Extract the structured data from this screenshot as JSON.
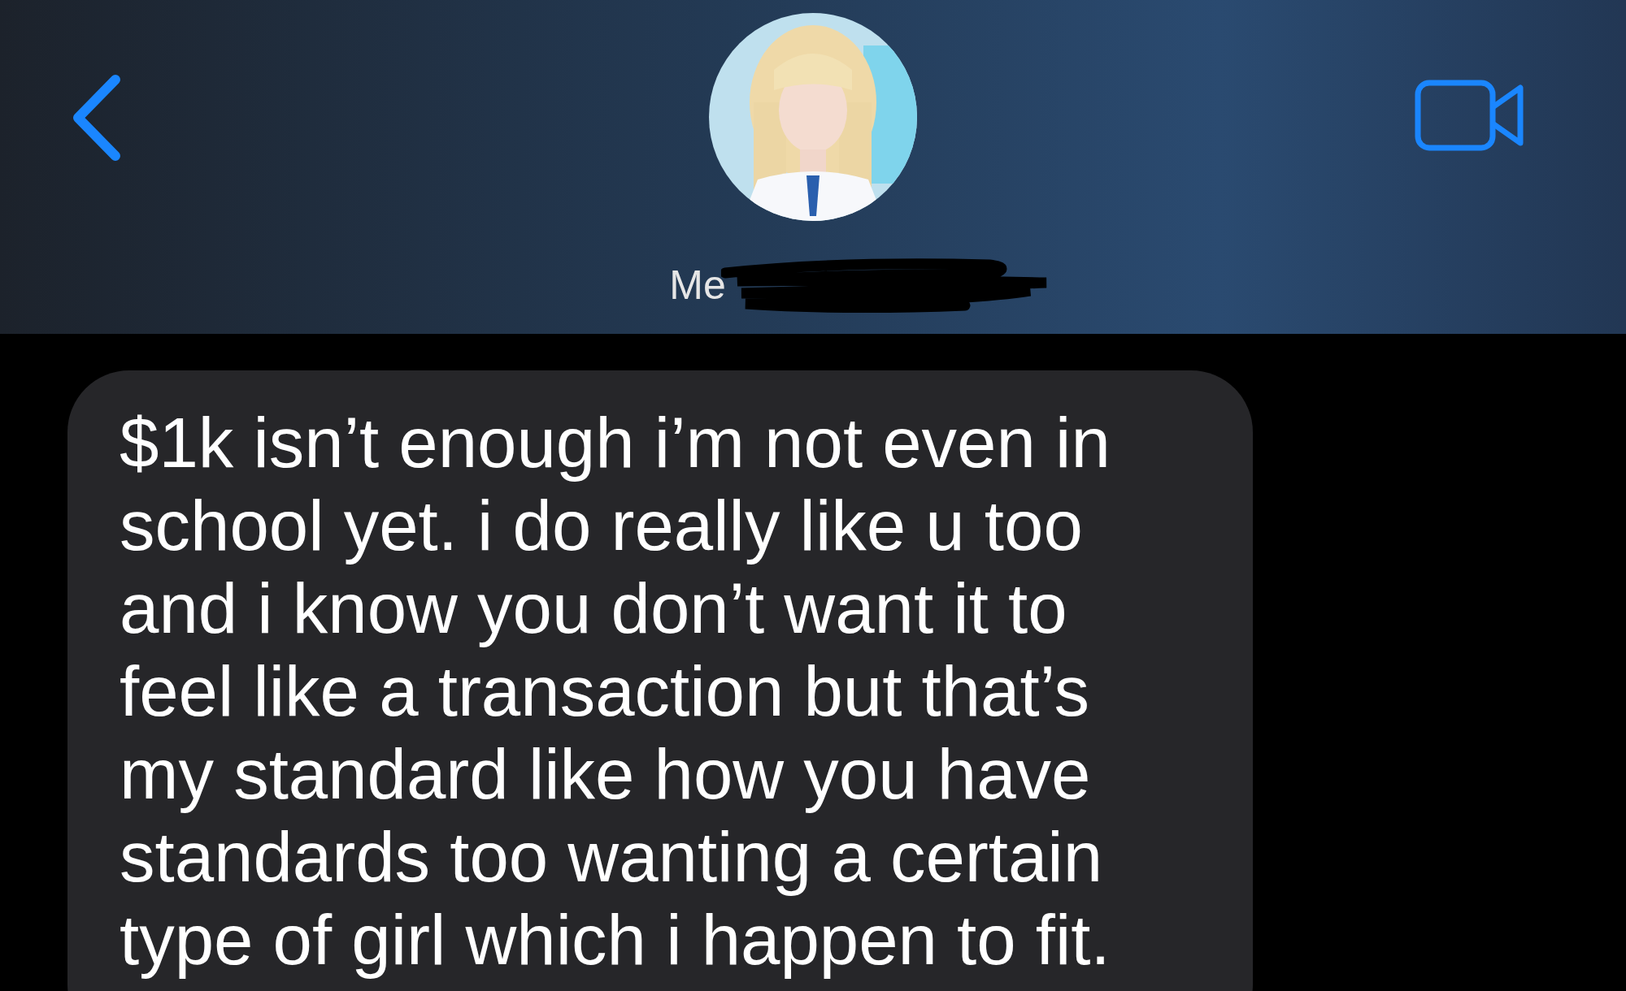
{
  "header": {
    "contact_name": "Me",
    "name_redacted": true
  },
  "messages": [
    {
      "kind": "received",
      "text": "$1k isn’t enough i’m not even in\nschool yet. i do really like u too\nand i know you don’t want it to\nfeel like a transaction but that’s\nmy standard like how you have\nstandards too wanting a certain\ntype of girl which i happen to fit."
    }
  ]
}
